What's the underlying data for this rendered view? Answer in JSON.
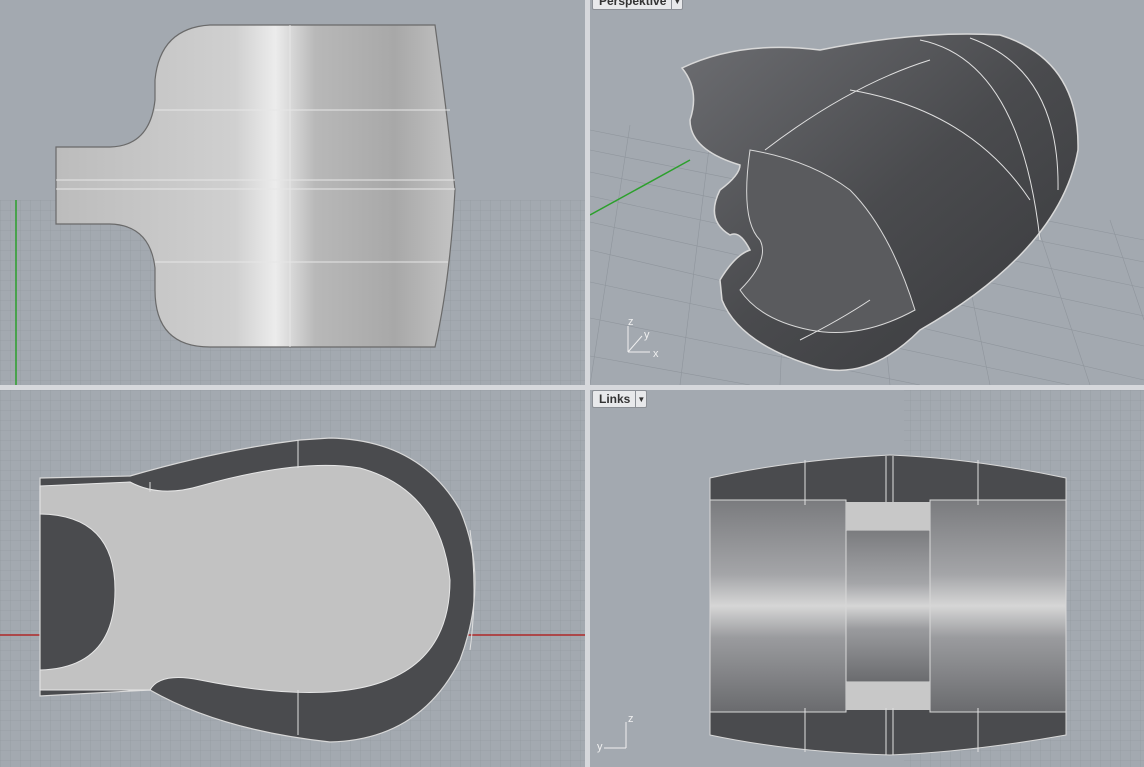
{
  "viewports": {
    "top": {
      "title": ""
    },
    "perspective": {
      "title": "Perspektive",
      "axes": {
        "z": "z",
        "y": "y",
        "x": "x"
      }
    },
    "front": {
      "title": ""
    },
    "left": {
      "title": "Links",
      "axes": {
        "z": "z",
        "y": "y"
      }
    }
  },
  "colors": {
    "viewport_bg": "#a3a9b0",
    "grid_line": "#8f959c",
    "x_axis": "#b02828",
    "y_axis": "#2ca02c",
    "surface_light": "#c8c8c8",
    "surface_dark": "#4a4b4e",
    "edge": "#e6e6e6"
  }
}
